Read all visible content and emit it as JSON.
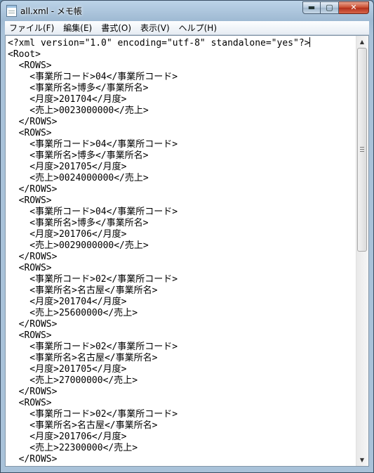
{
  "window": {
    "title": "all.xml - メモ帳",
    "controls": {
      "minimize": "▬",
      "maximize": "▢",
      "close": "✕"
    }
  },
  "menu": {
    "items": [
      "ファイル(F)",
      "編集(E)",
      "書式(O)",
      "表示(V)",
      "ヘルプ(H)"
    ]
  },
  "document": {
    "lines": [
      "<?xml version=\"1.0\" encoding=\"utf-8\" standalone=\"yes\"?>",
      "<Root>",
      "  <ROWS>",
      "    <事業所コード>04</事業所コード>",
      "    <事業所名>博多</事業所名>",
      "    <月度>201704</月度>",
      "    <売上>0023000000</売上>",
      "  </ROWS>",
      "  <ROWS>",
      "    <事業所コード>04</事業所コード>",
      "    <事業所名>博多</事業所名>",
      "    <月度>201705</月度>",
      "    <売上>0024000000</売上>",
      "  </ROWS>",
      "  <ROWS>",
      "    <事業所コード>04</事業所コード>",
      "    <事業所名>博多</事業所名>",
      "    <月度>201706</月度>",
      "    <売上>0029000000</売上>",
      "  </ROWS>",
      "  <ROWS>",
      "    <事業所コード>02</事業所コード>",
      "    <事業所名>名古屋</事業所名>",
      "    <月度>201704</月度>",
      "    <売上>25600000</売上>",
      "  </ROWS>",
      "  <ROWS>",
      "    <事業所コード>02</事業所コード>",
      "    <事業所名>名古屋</事業所名>",
      "    <月度>201705</月度>",
      "    <売上>27000000</売上>",
      "  </ROWS>",
      "  <ROWS>",
      "    <事業所コード>02</事業所コード>",
      "    <事業所名>名古屋</事業所名>",
      "    <月度>201706</月度>",
      "    <売上>22300000</売上>",
      "  </ROWS>"
    ]
  },
  "scrollbar": {
    "up_arrow": "▲",
    "down_arrow": "▼"
  },
  "colors": {
    "titlebar": "#a9c2d9",
    "close_button": "#c8482c",
    "editor_bg": "#ffffff"
  }
}
